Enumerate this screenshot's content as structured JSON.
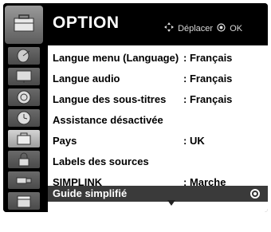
{
  "header": {
    "title": "OPTION",
    "icon": "option-toolbox-icon",
    "hint": {
      "move_icon": "move-arrows-icon",
      "move_label": "Déplacer",
      "ok_icon": "ok-circle-icon",
      "ok_label": "OK"
    }
  },
  "sidebar": {
    "items": [
      {
        "icon": "satellite-dish-icon",
        "name": "setup"
      },
      {
        "icon": "tv-picture-icon",
        "name": "picture"
      },
      {
        "icon": "speaker-icon",
        "name": "audio"
      },
      {
        "icon": "clock-icon",
        "name": "time"
      },
      {
        "icon": "toolbox-icon",
        "name": "option",
        "active": true
      },
      {
        "icon": "lock-icon",
        "name": "lock"
      },
      {
        "icon": "usb-icon",
        "name": "usb"
      },
      {
        "icon": "clapperboard-icon",
        "name": "movie"
      }
    ]
  },
  "menu": {
    "items": [
      {
        "label": "Langue menu (Language)",
        "value": ": Français"
      },
      {
        "label": "Langue audio",
        "value": ": Français"
      },
      {
        "label": "Langue des sous-titres",
        "value": ": Français"
      },
      {
        "label": "Assistance désactivée",
        "value": ""
      },
      {
        "label": "Pays",
        "value": ": UK"
      },
      {
        "label": "Labels des sources",
        "value": ""
      },
      {
        "label": "SIMPLINK",
        "value": ": Marche"
      },
      {
        "label": "Guide simplifié",
        "value": "",
        "selected": true
      }
    ],
    "more_icon": "scroll-down-arrow-icon"
  }
}
